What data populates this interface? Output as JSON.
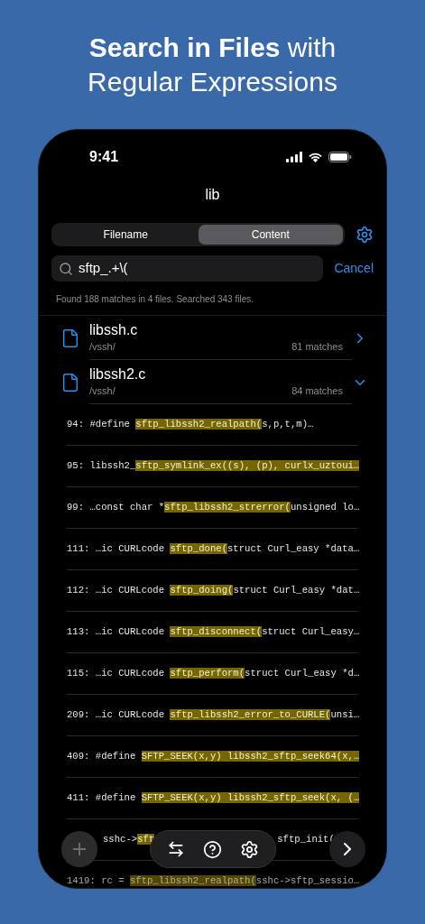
{
  "headline": {
    "bold": "Search in Files",
    "rest": "with",
    "line2": "Regular Expressions"
  },
  "status_bar": {
    "time": "9:41"
  },
  "title": "lib",
  "tabs": [
    {
      "label": "Filename",
      "selected": false
    },
    {
      "label": "Content",
      "selected": true
    }
  ],
  "search": {
    "value": "sftp_.+\\(",
    "cancel": "Cancel"
  },
  "summary": "Found 188 matches in 4 files. Searched 343 files.",
  "files": [
    {
      "name": "libssh.c",
      "path": "/vssh/",
      "matches": "81 matches",
      "expanded": false
    },
    {
      "name": "libssh2.c",
      "path": "/vssh/",
      "matches": "84 matches",
      "expanded": true
    }
  ],
  "lines": [
    {
      "kind": "full",
      "line": "94:",
      "before": "#define ",
      "match": "sftp_libssh2_realpath(",
      "after": "s,p,t,m)…"
    },
    {
      "kind": "full",
      "line": "95:",
      "before": "libssh2_",
      "match": "sftp_symlink_ex((s), (p), curlx_uztoui…"
    },
    {
      "kind": "full",
      "line": "99:",
      "before": "…const char *",
      "match": "sftp_libssh2_strerror(",
      "after": "unsigned lo…"
    },
    {
      "kind": "full",
      "line": "111:",
      "before": "…ic CURLcode ",
      "match": "sftp_done(",
      "after": "struct Curl_easy *data…"
    },
    {
      "kind": "full",
      "line": "112:",
      "before": "…ic CURLcode ",
      "match": "sftp_doing(",
      "after": "struct Curl_easy *dat…"
    },
    {
      "kind": "full",
      "line": "113:",
      "before": "…ic CURLcode ",
      "match": "sftp_disconnect(",
      "after": "struct Curl_easy…"
    },
    {
      "kind": "full",
      "line": "115:",
      "before": "…ic CURLcode ",
      "match": "sftp_perform(",
      "after": "struct Curl_easy *d…"
    },
    {
      "kind": "full",
      "line": "209:",
      "before": "…ic CURLcode ",
      "match": "sftp_libssh2_error_to_CURLE(",
      "after": "unsi…"
    },
    {
      "kind": "full",
      "line": "409:",
      "before": "#define ",
      "match": "SFTP_SEEK(x,y) libssh2_sftp_seek64(x,…"
    },
    {
      "kind": "full",
      "line": "411:",
      "before": "#define ",
      "match": "SFTP_SEEK(x,y) libssh2_sftp_seek(x, (…"
    },
    {
      "kind": "partial",
      "before": "sshc->",
      "match": "sft",
      "after": "sftp_init("
    },
    {
      "kind": "full",
      "line": "1419:",
      "before": "rc = ",
      "match": "sftp_libssh2_realpath(",
      "after": "sshc->sftp_sessio…"
    }
  ]
}
